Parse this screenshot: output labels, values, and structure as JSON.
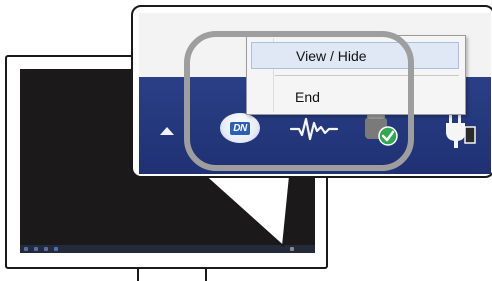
{
  "context_menu": {
    "items": [
      {
        "label": "View / Hide"
      },
      {
        "label": "End"
      }
    ]
  },
  "tray": {
    "icons": [
      "show-hidden-icons-arrow",
      "dn-app-icon",
      "pulse-wave-icon",
      "network-check-icon",
      "power-plug-icon"
    ],
    "dn_icon_text": "DN"
  },
  "colors": {
    "taskbar": "#243a7f",
    "highlight_ring": "#9e9e9e",
    "menu_hover": "#dfe8f4",
    "screen": "#1b1919"
  }
}
